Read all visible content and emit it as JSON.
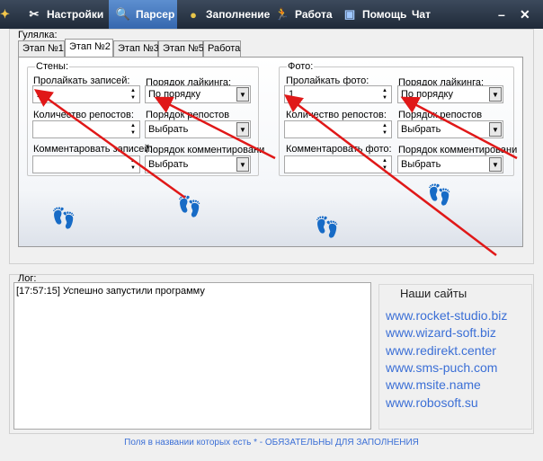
{
  "menu": {
    "items": [
      {
        "label": "Настройки",
        "icon": "tools-icon"
      },
      {
        "label": "Парсер",
        "icon": "magnifier-icon"
      },
      {
        "label": "Заполнение",
        "icon": "fill-icon"
      },
      {
        "label": "Работа",
        "icon": "runner-icon"
      },
      {
        "label": "Помощь",
        "icon": "help-icon"
      },
      {
        "label": "Чат",
        "icon": ""
      }
    ],
    "minimize": "–",
    "close": "✕"
  },
  "main": {
    "group_label": "Гулялка:",
    "tabs": [
      "Этап №1",
      "Этап №2",
      "Этап №3",
      "Этап №5",
      "Работа"
    ],
    "walls": {
      "title": "Стены:",
      "like_records_label": "Пролайкать записей:",
      "like_records_value": "2",
      "like_order_label": "Порядок лайкинга:",
      "like_order_value": "По порядку",
      "reposts_count_label": "Количество репостов:",
      "reposts_count_value": "",
      "reposts_order_label": "Порядок репостов",
      "reposts_order_value": "Выбрать",
      "comment_records_label": "Комментаровать записей:",
      "comment_records_value": "",
      "comment_order_label": "Порядок комментировани",
      "comment_order_value": "Выбрать"
    },
    "photo": {
      "title": "Фото:",
      "like_photo_label": "Пролайкать фото:",
      "like_photo_value": "1",
      "like_order_label": "Порядок лайкинга:",
      "like_order_value": "По порядку",
      "reposts_count_label": "Количество репостов:",
      "reposts_count_value": "",
      "reposts_order_label": "Порядок репостов",
      "reposts_order_value": "Выбрать",
      "comment_photo_label": "Комментаровать фото:",
      "comment_photo_value": "",
      "comment_order_label": "Порядок комментировани",
      "comment_order_value": "Выбрать"
    }
  },
  "log": {
    "label": "Лог:",
    "entries": [
      "[17:57:15] Успешно запустили программу"
    ]
  },
  "sites": {
    "title": "Наши сайты",
    "links": [
      "www.rocket-studio.biz",
      "www.wizard-soft.biz",
      "www.redirekt.center",
      "www.sms-puch.com",
      "www.msite.name",
      "www.robosoft.su"
    ]
  },
  "footer": "Поля в названии которых есть * - ОБЯЗАТЕЛЬНЫ ДЛЯ ЗАПОЛНЕНИЯ",
  "colors": {
    "accent": "#3b6fd6",
    "arrow": "#e01818",
    "titlebar": "#2b3646",
    "active_tab": "#4a7cc2"
  }
}
